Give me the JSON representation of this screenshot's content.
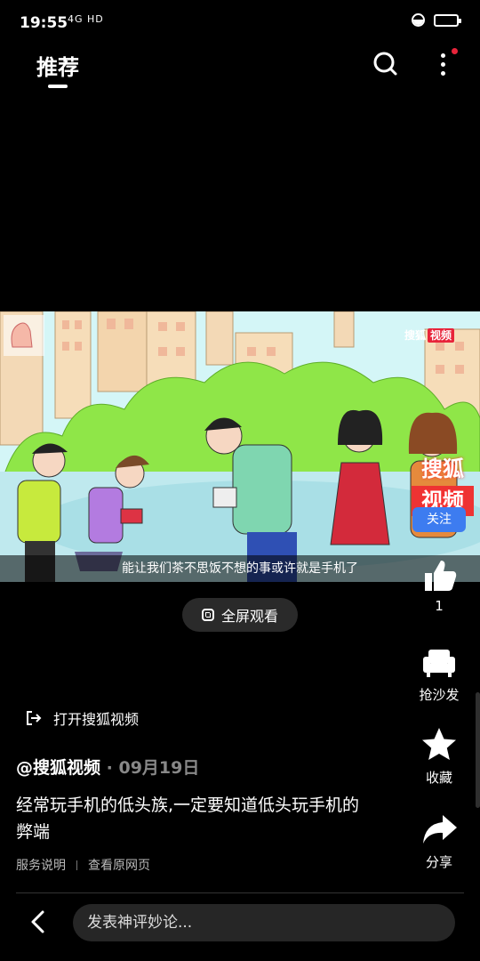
{
  "status_bar": {
    "time": "19:55",
    "network": "4G HD"
  },
  "header": {
    "tab_label": "推荐"
  },
  "video": {
    "subtitle": "能让我们茶不思饭不想的事或许就是手机了",
    "watermark_brand": "搜狐",
    "watermark_tag": "视频",
    "watermark_big_top": "搜狐",
    "watermark_big_bottom": "视频",
    "follow_label": "关注"
  },
  "fullscreen_label": "全屏观看",
  "rail": {
    "like_count": "1",
    "sofa_label": "抢沙发",
    "favorite_label": "收藏",
    "share_label": "分享"
  },
  "info": {
    "open_app_label": "打开搜狐视频",
    "author": "@搜狐视频",
    "date": "09月19日",
    "description": "经常玩手机的低头族,一定要知道低头玩手机的弊端",
    "link_service": "服务说明",
    "link_original": "查看原网页"
  },
  "bottom": {
    "comment_placeholder": "发表神评妙论..."
  },
  "colors": {
    "background": "#000000",
    "accent_blue": "#3d7cf0",
    "notification_red": "#e8243a"
  }
}
